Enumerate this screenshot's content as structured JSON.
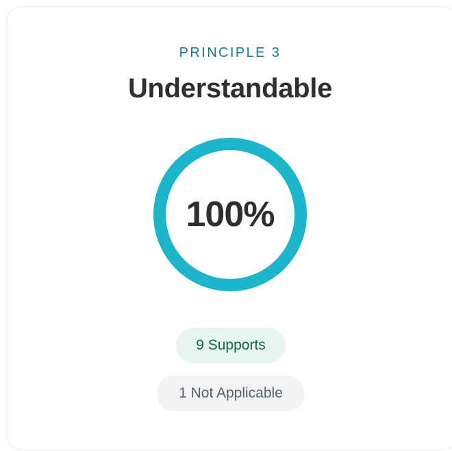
{
  "principle": {
    "eyebrow": "PRINCIPLE 3",
    "title": "Understandable",
    "score_label": "100%",
    "score_fraction": 1.0,
    "ring_color": "#1cb5c9",
    "badges": [
      {
        "label": "9 Supports",
        "background": "#e6f6ee",
        "color": "#0f6b3a"
      },
      {
        "label": "1 Not Applicable",
        "background": "#f2f3f5",
        "color": "#5a5f68"
      }
    ]
  }
}
